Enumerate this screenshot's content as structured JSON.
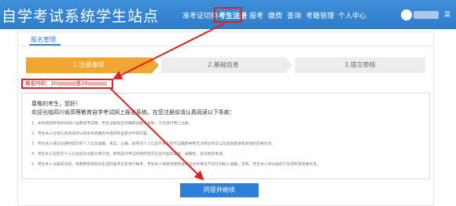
{
  "header": {
    "site_title": "自学考试系统学生站点",
    "nav": [
      {
        "label": "准考证切换",
        "active": false
      },
      {
        "label": "考生注册",
        "active": true
      },
      {
        "label": "报考",
        "active": false
      },
      {
        "label": "缴费",
        "active": false
      },
      {
        "label": "查询",
        "active": false
      },
      {
        "label": "考籍管理",
        "active": false
      },
      {
        "label": "个人中心",
        "active": false
      }
    ],
    "user_suffix": "菜"
  },
  "tab": {
    "label": "报名管理"
  },
  "steps": [
    {
      "label": "1.注册事项",
      "active": true
    },
    {
      "label": "2.基础信息",
      "active": false
    },
    {
      "label": "3.提交审核",
      "active": false
    }
  ],
  "registration_time": {
    "prefix": "报名时间：20",
    "middle": "至20"
  },
  "notice": {
    "greeting": "尊敬的考生，您好！",
    "intro": "欢迎光临四川省高等教育自学考试网上报名系统。在您注册前请认真阅读以下条款：",
    "items": [
      "1、本系统的所有权归四川省教育考试院，考生注册前应仔细阅读服务条款，方可进行网上注册。",
      "2、考生本人已经认真阅读并认同本系统服务中提供的全部文件的内容。",
      "3、考生本人保证注册时提交的个人信息准确、真实，正确，如有对个人信息不真实或不正确而导致无法参加考试以及其他直接或间接的后果负责。",
      "4、考生本人在提交个人信息成功注册为用户后，即构成对考试机构所提交信息内容真实性、准确性、合法性的承诺。",
      "5、考生本人注册成功后，将使用系统自动生成的准考证号进行报考，考生本人将妥善保管准考证号并保证不向任何他人透露。否则，考生本人将对由此产生的所有后果负责。"
    ]
  },
  "agree_button": {
    "label": "同意并继续"
  },
  "colors": {
    "header_bg": "#2e7dcc",
    "step_active": "#f2a632",
    "step_inactive": "#ededed",
    "highlight_red": "#e02020",
    "button_blue": "#2f7fd8"
  },
  "icons": {
    "avatar": "user-avatar-icon",
    "annotation": "red-arrow"
  }
}
